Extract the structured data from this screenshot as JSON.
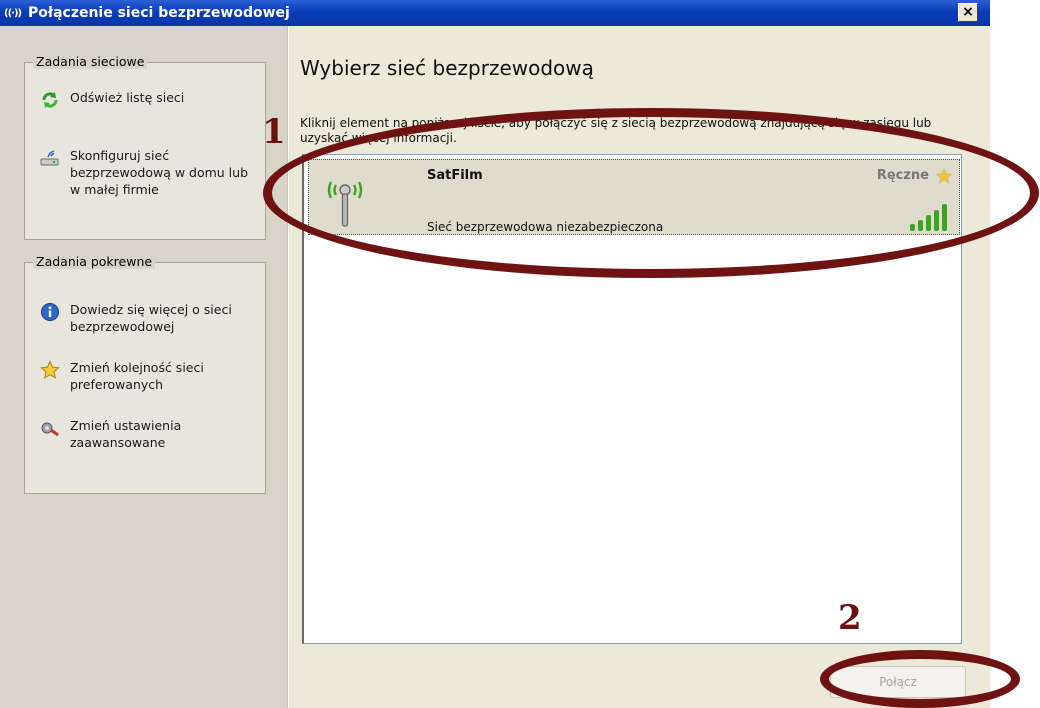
{
  "window": {
    "title": "Połączenie sieci bezprzewodowej",
    "title_icon": "wireless-icon",
    "close_label": "×"
  },
  "sidebar": {
    "network_tasks": {
      "legend": "Zadania sieciowe",
      "items": [
        {
          "label": "Odśwież listę sieci",
          "icon": "refresh-icon"
        },
        {
          "label": "Skonfiguruj sieć bezprzewodową w domu lub w małej firmie",
          "icon": "wizard-icon"
        }
      ]
    },
    "related_tasks": {
      "legend": "Zadania pokrewne",
      "items": [
        {
          "label": "Dowiedz się więcej o sieci bezprzewodowej",
          "icon": "info-icon"
        },
        {
          "label": "Zmień kolejność sieci preferowanych",
          "icon": "star-icon"
        },
        {
          "label": "Zmień ustawienia zaawansowane",
          "icon": "settings-icon"
        }
      ]
    }
  },
  "main": {
    "title": "Wybierz sieć bezprzewodową",
    "description": "Kliknij element na poniższej liście, aby połączyć się z siecią bezprzewodową znajdującą się w zasięgu lub uzyskać więcej informacji.",
    "networks": [
      {
        "name": "SatFilm",
        "status": "Sieć bezprzewodowa niezabezpieczona",
        "type": "Ręczne",
        "signal_bars": 5,
        "signal_max": 5
      }
    ],
    "connect_button": "Połącz"
  },
  "annotations": {
    "marker_1": "1",
    "marker_2": "2"
  },
  "colors": {
    "titlebar": "#0a3db8",
    "annotation": "#6f1212",
    "signal": "#3aa520"
  }
}
